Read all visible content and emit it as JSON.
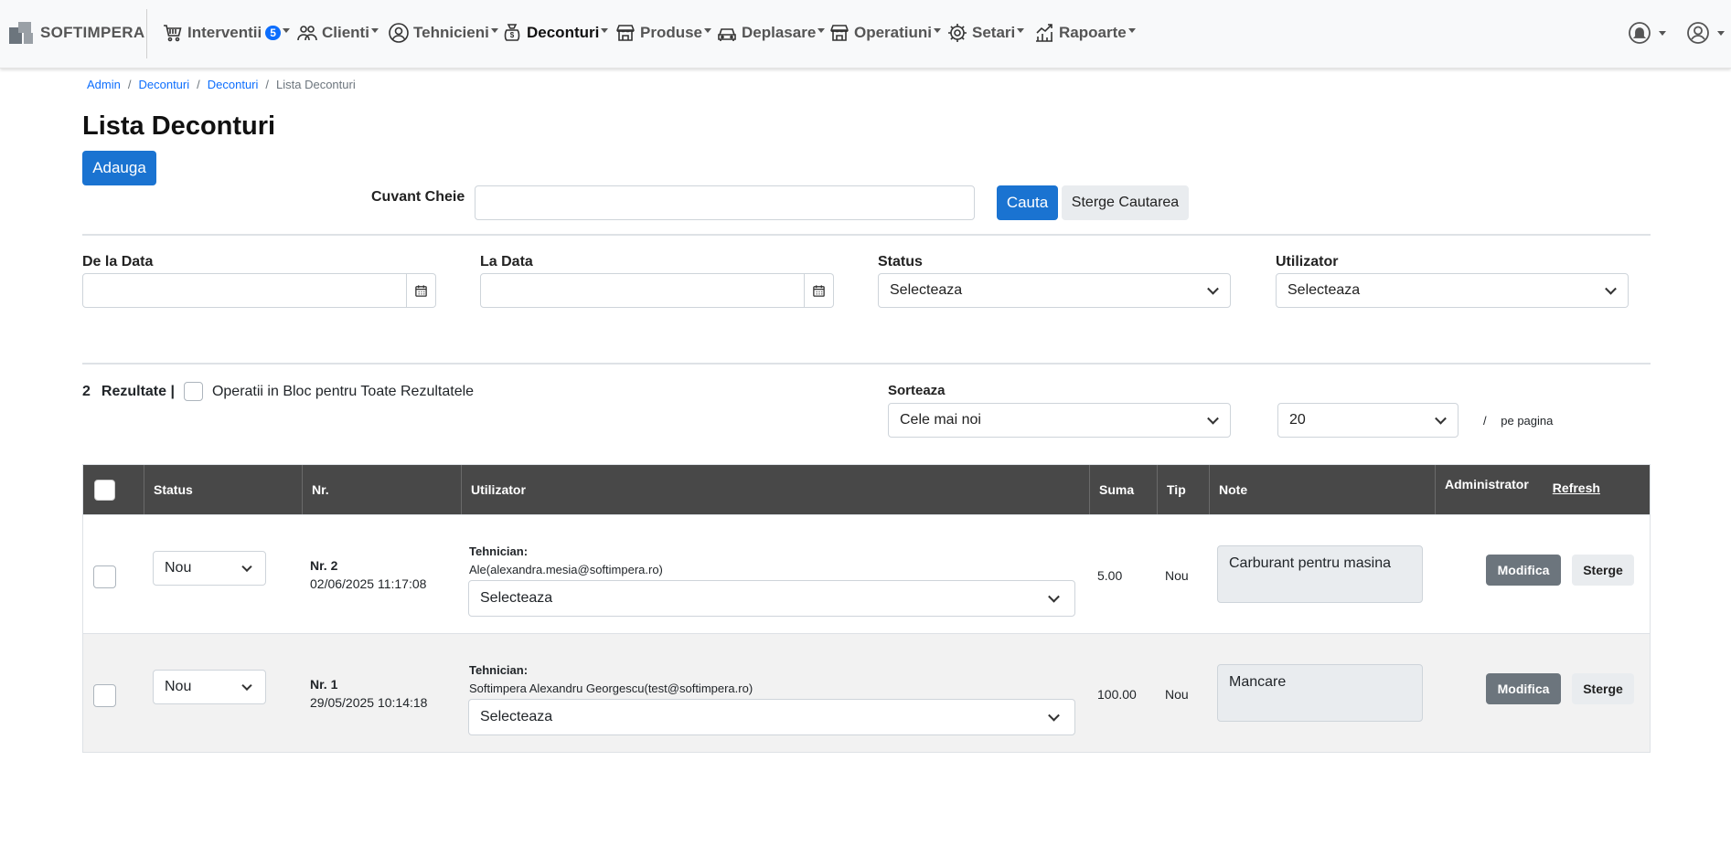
{
  "brand": {
    "name": "SOFTIMPERA"
  },
  "nav": {
    "items": [
      {
        "label": "Interventii",
        "icon": "cart-icon",
        "badge": "5"
      },
      {
        "label": "Clienti",
        "icon": "users-icon"
      },
      {
        "label": "Tehnicieni",
        "icon": "user-circle-icon"
      },
      {
        "label": "Deconturi",
        "icon": "money-bag-icon"
      },
      {
        "label": "Produse",
        "icon": "store-icon"
      },
      {
        "label": "Deplasare",
        "icon": "car-icon"
      },
      {
        "label": "Operatiuni",
        "icon": "store-icon"
      },
      {
        "label": "Setari",
        "icon": "gear-icon"
      },
      {
        "label": "Rapoarte",
        "icon": "chart-icon"
      }
    ]
  },
  "breadcrumb": [
    "Admin",
    "Deconturi",
    "Deconturi",
    "Lista Deconturi"
  ],
  "page": {
    "title": "Lista Deconturi",
    "add_label": "Adauga"
  },
  "search": {
    "keyword_label": "Cuvant Cheie",
    "keyword_value": "",
    "search_label": "Cauta",
    "clear_label": "Sterge Cautarea"
  },
  "filters": {
    "from_label": "De la Data",
    "to_label": "La Data",
    "status_label": "Status",
    "status_value": "Selecteaza",
    "user_label": "Utilizator",
    "user_value": "Selecteaza"
  },
  "results": {
    "count": "2",
    "label": "Rezultate |",
    "bulk_label": "Operatii in Bloc pentru Toate Rezultatele",
    "sort_label": "Sorteaza",
    "sort_value": "Cele mai noi",
    "per_page_value": "20",
    "per_page_sep": "/",
    "per_page_label": "pe pagina"
  },
  "table": {
    "headers": {
      "status": "Status",
      "nr": "Nr.",
      "user": "Utilizator",
      "sum": "Suma",
      "type": "Tip",
      "notes": "Note",
      "admin": "Administrator",
      "refresh": "Refresh"
    },
    "rows": [
      {
        "status": "Nou",
        "nr": "Nr. 2",
        "date": "02/06/2025 11:17:08",
        "role": "Tehnician:",
        "user": "Ale(alexandra.mesia@softimpera.ro)",
        "user_select": "Selecteaza",
        "sum": "5.00",
        "type": "Nou",
        "note": "Carburant pentru masina",
        "edit": "Modifica",
        "delete": "Sterge"
      },
      {
        "status": "Nou",
        "nr": "Nr. 1",
        "date": "29/05/2025 10:14:18",
        "role": "Tehnician:",
        "user": "Softimpera Alexandru Georgescu(test@softimpera.ro)",
        "user_select": "Selecteaza",
        "sum": "100.00",
        "type": "Nou",
        "note": "Mancare",
        "edit": "Modifica",
        "delete": "Sterge"
      }
    ]
  }
}
